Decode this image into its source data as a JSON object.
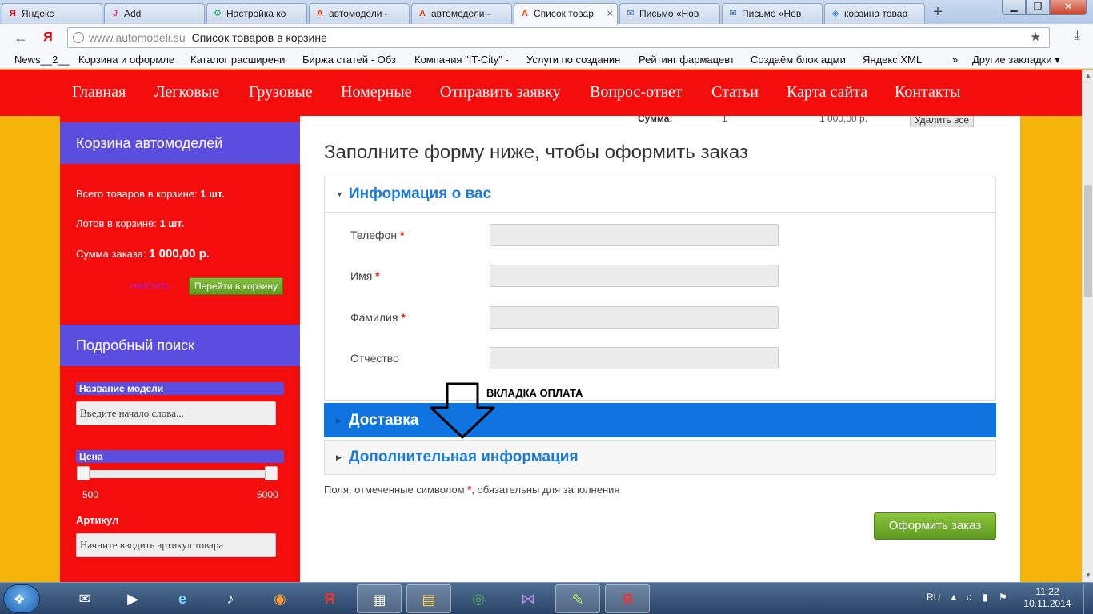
{
  "browser": {
    "tabs": [
      {
        "label": "Яндекс",
        "favicon": "Я"
      },
      {
        "label": "Add",
        "favicon": "J"
      },
      {
        "label": "Настройка ко",
        "favicon": "⚙"
      },
      {
        "label": "автомодели -",
        "favicon": "A"
      },
      {
        "label": "автомодели -",
        "favicon": "A"
      },
      {
        "label": "Список товар",
        "favicon": "A"
      },
      {
        "label": "Письмо «Нов",
        "favicon": "✉"
      },
      {
        "label": "Письмо «Нов",
        "favicon": "✉"
      },
      {
        "label": "корзина товар",
        "favicon": "◈"
      }
    ],
    "url_host": "www.automodeli.su",
    "url_title": "Список товаров в корзине",
    "bookmarks": [
      "News__2__",
      "Корзина и оформле",
      "Каталог расширени",
      "Биржа статей - Обз",
      "Компания \"IT-City\" -",
      "Услуги по созданин",
      "Рейтинг фармацевт",
      "Создаём блок адми",
      "Яндекс.XML",
      "»",
      "Другие закладки ▾"
    ]
  },
  "site": {
    "nav": [
      "Главная",
      "Легковые",
      "Грузовые",
      "Номерные",
      "Отправить заявку",
      "Вопрос-ответ",
      "Статьи",
      "Карта сайта",
      "Контакты"
    ],
    "cart": {
      "title": "Корзина автомоделей",
      "total_items_label": "Всего товаров в корзине:",
      "total_items_value": "1 шт.",
      "lots_label": "Лотов в корзине:",
      "lots_value": "1 шт.",
      "sum_label": "Сумма заказа:",
      "sum_value": "1 000,00 р.",
      "clear": "очистить",
      "go_to_cart": "Перейти в корзину"
    },
    "search": {
      "title": "Подробный поиск",
      "model_label": "Название модели",
      "model_placeholder": "Введите начало слова...",
      "price_label": "Цена",
      "price_min": "500",
      "price_max": "5000",
      "article_label": "Артикул",
      "article_placeholder": "Начните вводить артикул товара"
    },
    "top_strip": {
      "sum_label": "Сумма:",
      "qty": "1",
      "amount": "1 000,00 р.",
      "delete_all": "Удалить все"
    },
    "form": {
      "title": "Заполните форму ниже, чтобы оформить заказ",
      "section_info": "Информация о вас",
      "fields": [
        {
          "label": "Телефон",
          "required": "*"
        },
        {
          "label": "Имя",
          "required": "*"
        },
        {
          "label": "Фамилия",
          "required": "*"
        },
        {
          "label": "Отчество",
          "required": ""
        }
      ],
      "section_delivery": "Доставка",
      "section_extra": "Дополнительная информация",
      "note_before": "Поля, отмеченные символом",
      "note_star": "*",
      "note_after": ", обязательны для заполнения",
      "submit": "Оформить заказ"
    },
    "annotation": "ВКЛАДКА ОПЛАТА"
  },
  "taskbar": {
    "apps": [
      "thunderbird",
      "media",
      "ie",
      "audio",
      "firefox",
      "yandex",
      "calculator",
      "explorer",
      "chrome",
      "visual-studio",
      "notepad",
      "yandex-browser"
    ],
    "lang": "RU",
    "time": "11:22",
    "date": "10.11.2014"
  },
  "colors": {
    "site_red": "#f40d0d",
    "site_orange": "#f4b40a",
    "sidebar_head": "#5b4de0",
    "form_blue": "#0f74e0",
    "link_blue": "#1a7ad8",
    "button_green": "#6ea82d"
  }
}
